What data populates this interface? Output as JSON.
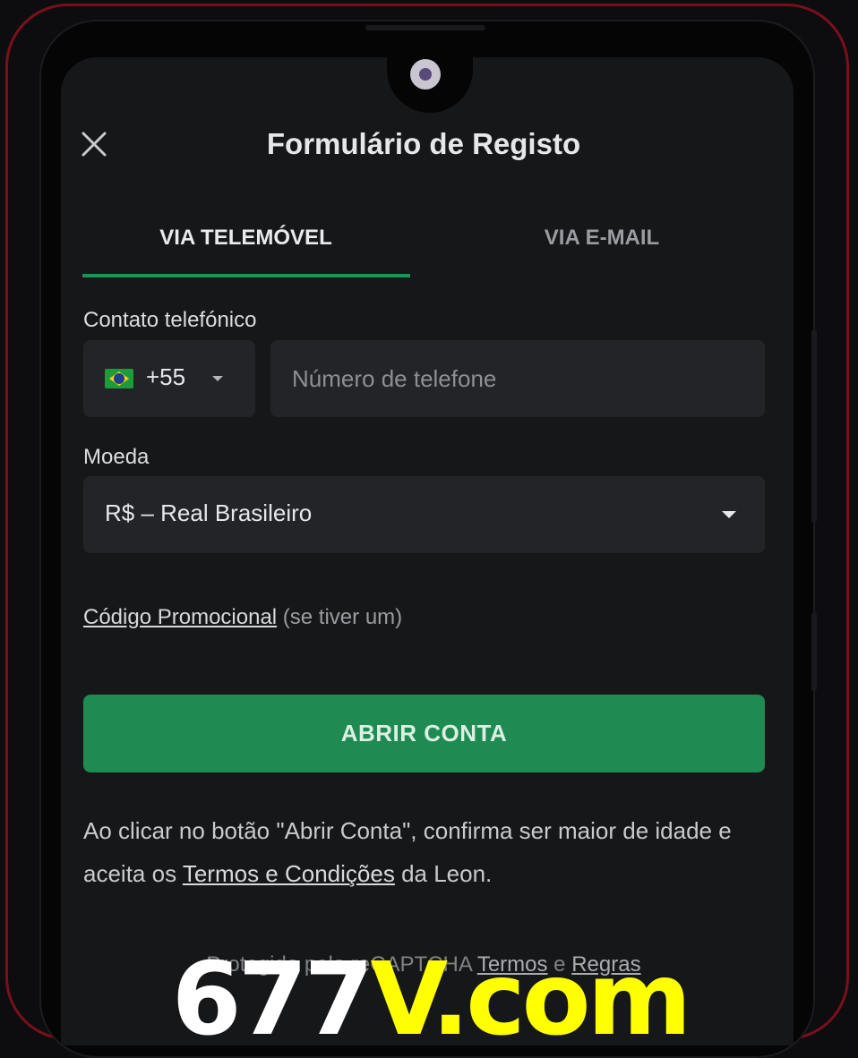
{
  "header": {
    "title": "Formulário de Registo",
    "close_icon": "close-icon"
  },
  "tabs": [
    {
      "label": "VIA TELEMÓVEL",
      "active": true
    },
    {
      "label": "VIA E-MAIL",
      "active": false
    }
  ],
  "phone": {
    "label": "Contato telefónico",
    "country_flag": "brazil-flag-icon",
    "dial_code": "+55",
    "placeholder": "Número de telefone",
    "value": ""
  },
  "currency": {
    "label": "Moeda",
    "selected": "R$ – Real Brasileiro"
  },
  "promo": {
    "link": "Código Promocional",
    "suffix": "(se tiver um)"
  },
  "submit": {
    "label": "ABRIR CONTA"
  },
  "disclaimer": {
    "before": "Ao clicar no botão \"Abrir Conta\", confirma ser maior de idade e aceita os",
    "link": "Termos e Condições",
    "after": "da Leon."
  },
  "captcha": {
    "prefix": "Protegido pelo reCAPTCHA",
    "terms": "Termos",
    "and": "e",
    "rules": "Regras"
  },
  "watermark": {
    "part1": "677",
    "part2": "V.com"
  },
  "colors": {
    "accent": "#1f8b53",
    "background": "#161719",
    "frame": "#7a0f1c",
    "watermark_yellow": "#ffff00"
  }
}
